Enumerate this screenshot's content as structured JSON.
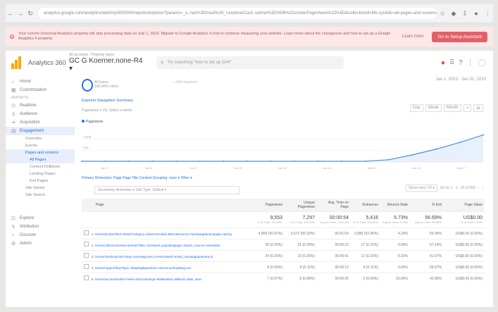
{
  "browser": {
    "url": "analytics.google.com/analytics/web/#/p0000000/reports/explorer?params=_u..nav%3Dmaui%26_r.explorerCard..selmet%3D%5B%22screenPageViews%22%5D&collectionId=life-cycle&r=all-pages-and-screens",
    "icons": [
      "back-icon",
      "forward-icon",
      "reload-icon",
      "bookmark-icon",
      "extension-icon",
      "download-icon",
      "profile-icon",
      "menu-icon"
    ]
  },
  "banner": {
    "message": "Your current Universal Analytics property will stop processing data on July 1, 2023. Migrate to Google Analytics 4 now to continue measuring your website. Learn more about the changeover and how to set up a Google Analytics 4 property.",
    "learn_more": "Learn more",
    "cta": "Go to Setup Assistant"
  },
  "header": {
    "product": "Analytics 360",
    "account_crumb": "All accounts › Property name",
    "account_name": "GC G Koerner.none-R4",
    "search_placeholder": "Try searching \"how to set up GA4\"",
    "icons": [
      "alert-icon",
      "apps-icon",
      "help-icon",
      "more-icon",
      "avatar"
    ]
  },
  "sidebar": {
    "items": [
      {
        "label": "Home",
        "icon": "home-icon"
      },
      {
        "label": "Customization",
        "icon": "customization-icon"
      }
    ],
    "section": "REPORTS",
    "reports": [
      {
        "label": "Realtime",
        "icon": "clock-icon"
      },
      {
        "label": "Audience",
        "icon": "person-icon"
      },
      {
        "label": "Acquisition",
        "icon": "acquisition-icon"
      },
      {
        "label": "Engagement",
        "icon": "behavior-icon",
        "selected": true
      }
    ],
    "sub_items": [
      {
        "label": "Overview",
        "selected": false
      },
      {
        "label": "Events",
        "selected": false
      },
      {
        "label": "Pages and screens",
        "selected": true
      },
      {
        "label": "All Pages",
        "selected": true
      },
      {
        "label": "Content Drilldown",
        "selected": false
      },
      {
        "label": "Landing Pages",
        "selected": false
      },
      {
        "label": "Exit Pages",
        "selected": false
      },
      {
        "label": "Site Speed",
        "selected": false
      },
      {
        "label": "Site Search",
        "selected": false
      }
    ],
    "bottom": [
      {
        "label": "Explore",
        "icon": "explore-icon"
      },
      {
        "label": "Attribution",
        "icon": "attribution-icon"
      },
      {
        "label": "Discover",
        "icon": "discover-icon"
      },
      {
        "label": "Admin",
        "icon": "gear-icon"
      }
    ]
  },
  "main": {
    "metric_label": "All Users\n100.00% Users",
    "add_segment": "+ Add Segment",
    "date_range": "Jan 1, 2023 - Jan 31, 2023",
    "tabs": "Explorer    Navigation Summary",
    "controls": "Pageviews  ▾  VS.  Select a metric",
    "chart_buttons": [
      "Day",
      "Week",
      "Month",
      "line-icon",
      "motion-icon"
    ],
    "legend": "Pageviews",
    "table_controls": "Primary Dimension:  Page   Page Title   Content Grouping: none ▾   Other ▾",
    "search_placeholder": "Secondary dimension ▾   Sort Type: Default ▾",
    "table_right": [
      "Show rows: 10 ▾",
      "Go to: 1",
      "1 - 10 of 250"
    ],
    "columns": [
      "Page",
      "Pageviews",
      "Unique Pageviews",
      "Avg. Time on Page",
      "Entrances",
      "Bounce Rate",
      "% Exit",
      "Page Value"
    ],
    "totals": [
      {
        "big": "9,553",
        "small": "% of Total: 100.00%"
      },
      {
        "big": "7,297",
        "small": "% of Total: 100.00%"
      },
      {
        "big": "00:00:54",
        "small": "Avg for View: 00:00:54"
      },
      {
        "big": "5,416",
        "small": "% of Total: 100.00%"
      },
      {
        "big": "5.73%",
        "small": "Avg for View: 5.73%"
      },
      {
        "big": "56.69%",
        "small": "Avg for View: 56.69%"
      },
      {
        "big": "US$0.00",
        "small": "% of Total: 0.00%"
      }
    ],
    "rows": [
      {
        "n": "1.",
        "page": "/en/us/product/item-detail?category=electronics&id=98213&source=homepage&campaign=spring",
        "pv": "4,869 (50.97%)",
        "upv": "3,672 (50.32%)",
        "time": "00:01:04",
        "ent": "2,895 (53.45%)",
        "bounce": "4.23%",
        "exit": "59.45%",
        "val": "US$0.00 (0.00%)"
      },
      {
        "n": "2.",
        "page": "/en/us/collections/new-arrivals?filter=size&sort=popular&page=2&utm_source=newsletter",
        "pv": "28 (0.29%)",
        "upv": "21 (0.29%)",
        "time": "00:00:23",
        "ent": "17 (0.31%)",
        "bounce": "0.00%",
        "exit": "57.14%",
        "val": "US$0.00 (0.00%)"
      },
      {
        "n": "3.",
        "page": "/en/us/checkout/cart?step=review&promo=SAVE10&ref=email_campaign&variant=b",
        "pv": "24 (0.25%)",
        "upv": "19 (0.26%)",
        "time": "00:00:41",
        "ent": "12 (0.22%)",
        "bounce": "8.33%",
        "exit": "41.67%",
        "val": "US$0.00 (0.00%)"
      },
      {
        "n": "4.",
        "page": "/en/us/support/faq?topic=shipping&question=returns-policy&lang=en",
        "pv": "9 (0.09%)",
        "upv": "8 (0.11%)",
        "time": "00:00:12",
        "ent": "6 (0.11%)",
        "bounce": "0.00%",
        "exit": "66.67%",
        "val": "US$0.00 (0.00%)"
      },
      {
        "n": "5.",
        "page": "/en/us/account/orders?view=history&range=90d&status=all&sort=date_desc",
        "pv": "7 (0.07%)",
        "upv": "6 (0.08%)",
        "time": "00:00:30",
        "ent": "5 (0.09%)",
        "bounce": "20.00%",
        "exit": "42.86%",
        "val": "US$0.00 (0.00%)"
      }
    ]
  },
  "chart_data": {
    "type": "line",
    "title": "",
    "xlabel": "",
    "ylabel": "",
    "x": [
      "",
      "",
      "",
      "",
      "",
      "",
      "",
      "",
      "",
      "",
      "",
      "",
      "",
      "",
      "",
      "",
      "",
      ""
    ],
    "series": [
      {
        "name": "Pageviews",
        "values": [
          20,
          20,
          20,
          20,
          20,
          20,
          20,
          20,
          20,
          20,
          20,
          20,
          20,
          60,
          190,
          340,
          520,
          720
        ]
      }
    ],
    "y_ticks": [
      "1,500",
      "750"
    ],
    "x_ticks": [
      "Jan 3",
      "Jan 6",
      "Jan 9",
      "Jan 12",
      "Jan 15",
      "Jan 18",
      "Jan 21",
      "Jan 24",
      "Jan 27"
    ],
    "ylim": [
      0,
      900
    ],
    "colors": {
      "line": "#4a90d9",
      "fill": "#e8f0fb"
    }
  }
}
